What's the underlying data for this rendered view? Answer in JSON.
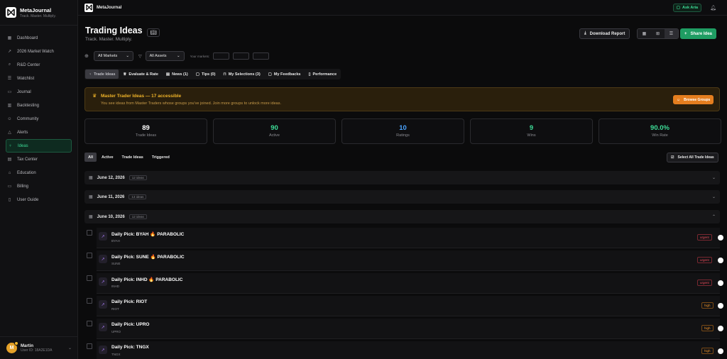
{
  "app": {
    "name": "MetaJournal",
    "tagline": "Track. Master. Multiply."
  },
  "sidebar": {
    "items": [
      {
        "label": "Dashboard",
        "icon": "grid-icon"
      },
      {
        "label": "2026 Market Watch",
        "icon": "trend-icon"
      },
      {
        "label": "R&D Center",
        "icon": "search-icon"
      },
      {
        "label": "Watchlist",
        "icon": "list-icon"
      },
      {
        "label": "Journal",
        "icon": "book-icon"
      },
      {
        "label": "Backtesting",
        "icon": "chart-icon"
      },
      {
        "label": "Community",
        "icon": "users-icon"
      },
      {
        "label": "Alerts",
        "icon": "bell-icon"
      },
      {
        "label": "Ideas",
        "icon": "lightbulb-icon",
        "active": true
      },
      {
        "label": "Tax Center",
        "icon": "receipt-icon"
      },
      {
        "label": "Education",
        "icon": "graduation-icon"
      },
      {
        "label": "Billing",
        "icon": "card-icon"
      },
      {
        "label": "User Guide",
        "icon": "guide-icon"
      }
    ],
    "user": {
      "name": "Martin",
      "id": "User ID: 18A2E1DA",
      "initial": "M"
    }
  },
  "topbar": {
    "title": "MetaJournal",
    "ask_label": "Ask Aria"
  },
  "page": {
    "title": "Trading Ideas",
    "subtitle": "Track. Master. Multiply.",
    "download_label": "Download Report",
    "share_label": "Share Idea"
  },
  "filters": {
    "markets": "All Markets",
    "assets": "All Assets",
    "your_markets": "Your markets:"
  },
  "tabs": [
    {
      "label": "Trade Ideas",
      "icon": "lightbulb-icon",
      "selected": true
    },
    {
      "label": "Evaluate & Rate",
      "icon": "trophy-icon"
    },
    {
      "label": "News (1)",
      "icon": "newspaper-icon"
    },
    {
      "label": "Tips (0)",
      "icon": "chat-icon"
    },
    {
      "label": "My Selections (3)",
      "icon": "bookmark-icon"
    },
    {
      "label": "My Feedbacks",
      "icon": "message-icon"
    },
    {
      "label": "Performance",
      "icon": "doc-icon"
    }
  ],
  "banner": {
    "title": "Master Trader Ideas — 17 accessible",
    "text": "You see ideas from Master Traders whose groups you've joined. Join more groups to unlock more ideas.",
    "button": "Browse Groups"
  },
  "stats": [
    {
      "value": "89",
      "label": "Trade Ideas",
      "color": "#ffffff"
    },
    {
      "value": "90",
      "label": "Active",
      "color": "#3ddc97"
    },
    {
      "value": "10",
      "label": "Ratings",
      "color": "#4aa3ff"
    },
    {
      "value": "9",
      "label": "Wins",
      "color": "#3ddc97"
    },
    {
      "value": "90.0%",
      "label": "Win Rate",
      "color": "#3ddc97"
    }
  ],
  "segments": [
    "All",
    "Active",
    "Trade Ideas",
    "Triggered"
  ],
  "select_all": "Select All Trade Ideas",
  "days": [
    {
      "date": "June 12, 2026",
      "count": "12 ideas"
    },
    {
      "date": "June 11, 2026",
      "count": "13 ideas"
    },
    {
      "date": "June 10, 2026",
      "count": "12 ideas"
    }
  ],
  "ideas": [
    {
      "title": "Daily Pick: BYAH 🔥 PARABOLIC",
      "ticker": "BYAH",
      "priority": "urgent"
    },
    {
      "title": "Daily Pick: SUNE 🔥 PARABOLIC",
      "ticker": "SUNE",
      "priority": "urgent"
    },
    {
      "title": "Daily Pick: INHD 🔥 PARABOLIC",
      "ticker": "INHD",
      "priority": "urgent"
    },
    {
      "title": "Daily Pick: RIOT",
      "ticker": "RIOT",
      "priority": "high"
    },
    {
      "title": "Daily Pick: UPRO",
      "ticker": "UPRO",
      "priority": "high"
    },
    {
      "title": "Daily Pick: TNGX",
      "ticker": "TNGX",
      "priority": "high"
    }
  ]
}
